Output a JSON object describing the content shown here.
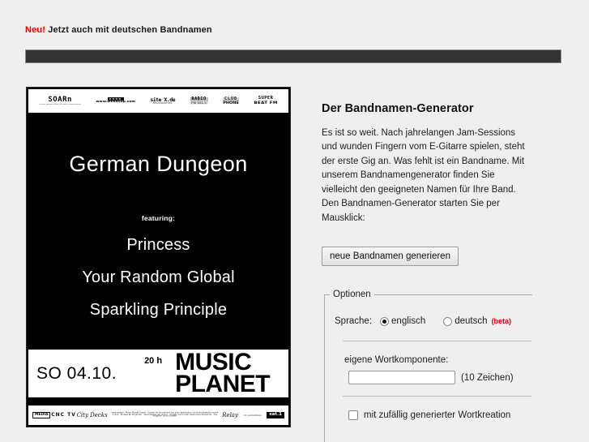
{
  "top_notice": {
    "badge": "Neu!",
    "text": "Jetzt auch mit deutschen Bandnamen"
  },
  "poster": {
    "headline": "German Dungeon",
    "featuring_label": "featuring:",
    "bands": [
      "Princess",
      "Your Random Global",
      "Sparkling Principle"
    ],
    "date": "SO 04.10.",
    "time": "20 h",
    "venue_line1": "MUSIC",
    "venue_line2": "PLANET",
    "sponsors_top": [
      {
        "mark": "SOARn",
        "sub": "Lorem ipsum dolor sit amet consectetur"
      },
      {
        "mark": "▬▬▬▬",
        "sub": "www.webshop.com"
      },
      {
        "mark": "site X.de",
        "sub": "MEDIENPARTNER"
      },
      {
        "mark": "RADIO",
        "sub": "FM 101.5"
      },
      {
        "mark": "CLUB",
        "sub": "PHONE"
      },
      {
        "mark": "SUPER",
        "sub": "BEAT FM"
      }
    ],
    "sponsors_bottom": [
      {
        "text": "MEDIA"
      },
      {
        "text": "CNC TV"
      },
      {
        "text": "City Decks"
      },
      {
        "text": "Veranstalter: Music Planet GmbH · Karten im Vorverkauf bei allen bekannten Vorverkaufsstellen sowie online · Einlass ab 18 Jahren · Abendkasse ab 19 Uhr · Tickets auch unter www.musicplanet.de · Alle Angaben ohne Gewähr"
      },
      {
        "text": "Relay"
      },
      {
        "text": "CC promotions"
      },
      {
        "text": "sat.1"
      }
    ]
  },
  "generator": {
    "title": "Der Bandnamen-Generator",
    "paragraph": "Es ist so weit. Nach jahrelangen Jam-Sessions und wunden Fingern vom E-Gitarre spielen, steht der erste Gig an. Was fehlt ist ein Bandname. Mit unserem Bandnamengenerator finden Sie vielleicht den geeigneten Namen für Ihre Band. Den Bandnamen-Generator starten Sie per Mausklick:",
    "button_label": "neue Bandnamen generieren"
  },
  "options": {
    "legend": "Optionen",
    "language_label": "Sprache:",
    "language_choices": [
      {
        "label": "englisch",
        "selected": true,
        "beta": ""
      },
      {
        "label": "deutsch",
        "selected": false,
        "beta": "(beta)"
      }
    ],
    "wordcomponent_label": "eigene Wortkomponente:",
    "wordcomponent_value": "",
    "wordcomponent_placeholder": "",
    "wordcomponent_hint": "(10 Zeichen)",
    "random_creation_label": "mit zufällig generierter Wortkreation",
    "random_creation_checked": false
  },
  "colors": {
    "accent_red": "#ee0000",
    "page_bg": "#efeff0",
    "header_bar": "#333333"
  }
}
